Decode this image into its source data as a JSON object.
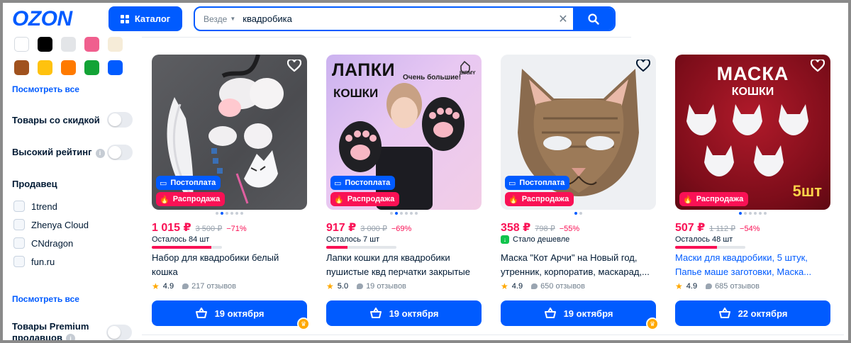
{
  "header": {
    "logo": "OZON",
    "catalog_label": "Каталог",
    "search_scope": "Везде",
    "search_value": "квадробика"
  },
  "filters": {
    "colors": [
      "#ffffff",
      "#000000",
      "#e3e5e8",
      "#f05f8e",
      "#f6ecd8",
      "#a0521e",
      "#ffc20e",
      "#ff7a00",
      "#13a336",
      "#005bff"
    ],
    "show_all_colors": "Посмотреть все",
    "discount_toggle": "Товары со скидкой",
    "rating_toggle": "Высокий рейтинг",
    "info_icon": "i",
    "seller_title": "Продавец",
    "sellers": [
      "1trend",
      "Zhenya Cloud",
      "CNdragon",
      "fun.ru"
    ],
    "show_all_sellers": "Посмотреть все",
    "premium_line1": "Товары Premium",
    "premium_line2": "продавцов"
  },
  "products": [
    {
      "badge_postpay": "Постоплата",
      "badge_sale": "Распродажа",
      "price": "1 015 ₽",
      "old_price": "3 500 ₽",
      "discount": "−71%",
      "stock_text": "Осталось 84 шт",
      "stock_fraction": 0.85,
      "name": "Набор для квадробики белый кошка",
      "rating": "4.9",
      "reviews": "217 отзывов",
      "delivery": "19 октября",
      "crown": true
    },
    {
      "badge_postpay": "Постоплата",
      "badge_sale": "Распродажа",
      "price": "917 ₽",
      "old_price": "3 000 ₽",
      "discount": "−69%",
      "stock_text": "Осталось 7 шт",
      "stock_fraction": 0.3,
      "name": "Лапки кошки для квадробики пушистые квд перчатки закрытые",
      "rating": "5.0",
      "reviews": "19 отзывов",
      "delivery": "19 октября",
      "image_title_1": "ЛАПКИ",
      "image_title_2": "КОШКИ",
      "image_caption": "Очень большие!",
      "image_brand": "BIRMY"
    },
    {
      "badge_postpay": "Постоплата",
      "badge_sale": "Распродажа",
      "price": "358 ₽",
      "old_price": "798 ₽",
      "discount": "−55%",
      "cheaper_text": "Стало дешевле",
      "name": "Маска \"Кот Арчи\" на Новый год, утренник, корпоратив, маскарад,...",
      "rating": "4.9",
      "reviews": "650 отзывов",
      "delivery": "19 октября",
      "crown": true
    },
    {
      "badge_sale": "Распродажа",
      "price": "507 ₽",
      "old_price": "1 112 ₽",
      "discount": "−54%",
      "stock_text": "Осталось 48 шт",
      "stock_fraction": 0.6,
      "name": "Маски для квадробики, 5 штук, Папье маше заготовки, Маска...",
      "rating": "4.9",
      "reviews": "685 отзывов",
      "delivery": "22 октября",
      "image_title_1": "МАСКА",
      "image_title_2": "КОШКИ",
      "image_count": "5шт"
    }
  ]
}
